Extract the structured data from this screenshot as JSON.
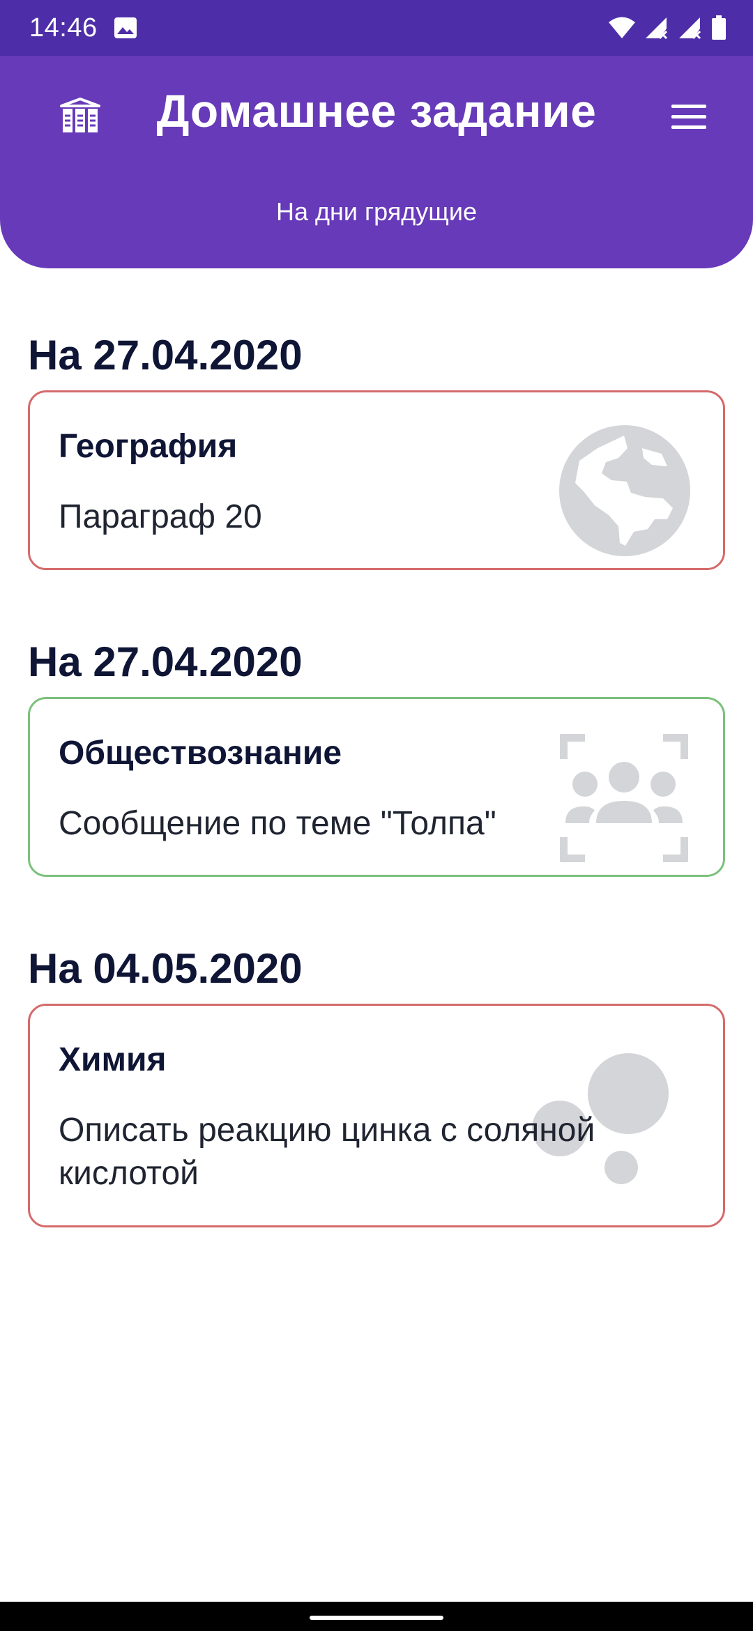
{
  "status_bar": {
    "time": "14:46",
    "left_icons": [
      "gallery-icon"
    ],
    "right_icons": [
      "wifi-icon",
      "signal-no-service-icon",
      "signal-no-service-icon",
      "battery-icon"
    ],
    "background_color": "#4d2ea8"
  },
  "header": {
    "title": "Домашнее задание",
    "subtitle": "На дни грядущие",
    "left_icon": "library-icon",
    "right_icon": "menu-icon",
    "background_color": "#663ab8"
  },
  "homework": [
    {
      "date_label": "На 27.04.2020",
      "subject": "География",
      "task": "Параграф 20",
      "icon": "globe-icon",
      "border_color": "#d56a6a"
    },
    {
      "date_label": "На 27.04.2020",
      "subject": "Обществознание",
      "task": "Сообщение по теме \"Толпа\"",
      "icon": "people-icon",
      "border_color": "#7cc07c"
    },
    {
      "date_label": "На 04.05.2020",
      "subject": "Химия",
      "task": "Описать реакцию цинка с соляной кислотой",
      "icon": "bubbles-icon",
      "border_color": "#d56a6a"
    }
  ],
  "colors": {
    "accent": "#663ab8",
    "text": "#0f1535",
    "icon_gray": "#d4d5d8"
  }
}
